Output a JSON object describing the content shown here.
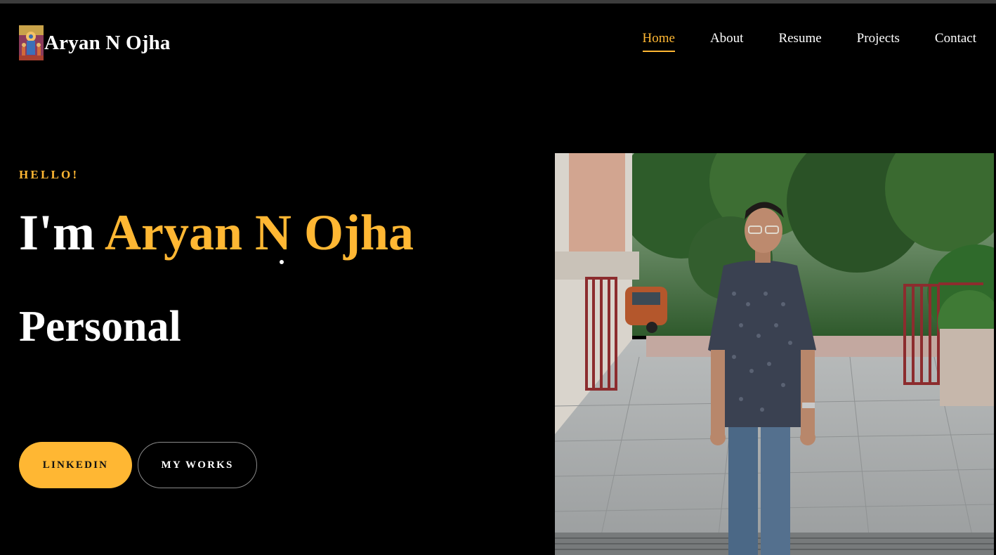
{
  "brand": {
    "name": "Aryan N Ojha",
    "logo_icon": "deity-portrait-icon"
  },
  "nav": {
    "items": [
      {
        "label": "Home",
        "active": true
      },
      {
        "label": "About",
        "active": false
      },
      {
        "label": "Resume",
        "active": false
      },
      {
        "label": "Projects",
        "active": false
      },
      {
        "label": "Contact",
        "active": false
      }
    ]
  },
  "hero": {
    "greeting": "HELLO!",
    "intro": "I'm",
    "name": "Aryan N Ojha",
    "role": "Personal",
    "buttons": {
      "linkedin": "LINKEDIN",
      "works": "MY WORKS"
    }
  },
  "colors": {
    "accent": "#ffb733",
    "background": "#000000",
    "text": "#ffffff"
  }
}
